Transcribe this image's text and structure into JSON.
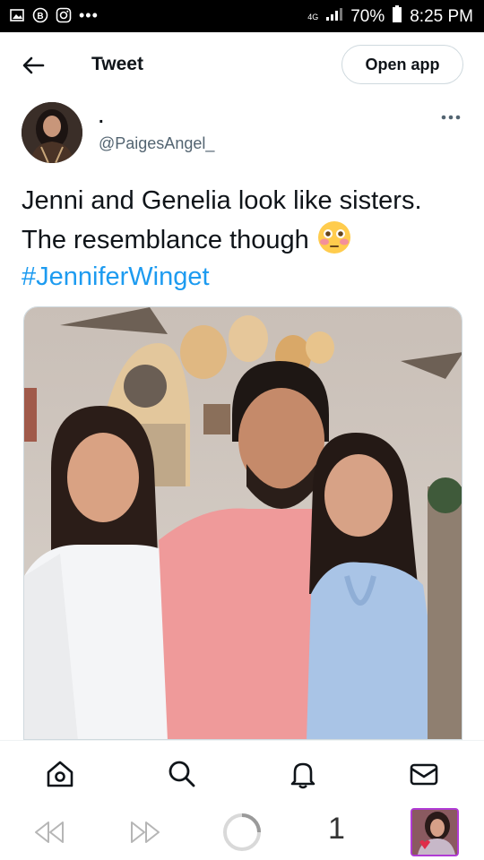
{
  "status_bar": {
    "network": "4G",
    "battery": "70%",
    "time": "8:25 PM",
    "icons": [
      "image-icon",
      "b-badge-icon",
      "instagram-icon",
      "more-dots-icon",
      "signal-icon",
      "battery-icon"
    ]
  },
  "header": {
    "title": "Tweet",
    "open_app_label": "Open app",
    "back_icon": "arrow-left-icon"
  },
  "tweet": {
    "display_name": ".",
    "handle": "@PaigesAngel_",
    "text": "Jenni and Genelia look like sisters. The resemblance though",
    "emoji": "flushed-face-emoji",
    "hashtag": "#JenniferWinget",
    "more_icon": "more-horizontal-icon",
    "media_description_icon": "photo"
  },
  "bottom_nav": {
    "items": [
      "home-icon",
      "search-icon",
      "notifications-icon",
      "messages-icon"
    ]
  },
  "browser_bar": {
    "tab_count": "1",
    "icons": [
      "rewind-icon",
      "fast-forward-icon",
      "loading-icon",
      "profile-thumbnail"
    ]
  },
  "colors": {
    "accent": "#1d9bf0",
    "text": "#0f1419",
    "secondary": "#536471",
    "border": "#cfd9de"
  }
}
